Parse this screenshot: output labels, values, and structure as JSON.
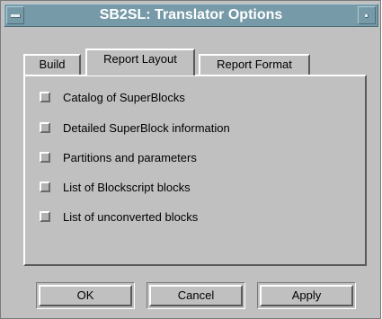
{
  "window": {
    "title": "SB2SL: Translator Options"
  },
  "tabs": [
    {
      "label": "Build",
      "active": false
    },
    {
      "label": "Report Layout",
      "active": true
    },
    {
      "label": "Report Format",
      "active": false
    }
  ],
  "options": [
    {
      "label": "Catalog of SuperBlocks",
      "checked": false
    },
    {
      "label": "Detailed SuperBlock information",
      "checked": false
    },
    {
      "label": "Partitions and parameters",
      "checked": false
    },
    {
      "label": "List of Blockscript blocks",
      "checked": false
    },
    {
      "label": "List of unconverted blocks",
      "checked": false
    }
  ],
  "buttons": {
    "ok": "OK",
    "cancel": "Cancel",
    "apply": "Apply"
  },
  "colors": {
    "titlebar": "#779aa8",
    "face": "#c0c0c0"
  }
}
